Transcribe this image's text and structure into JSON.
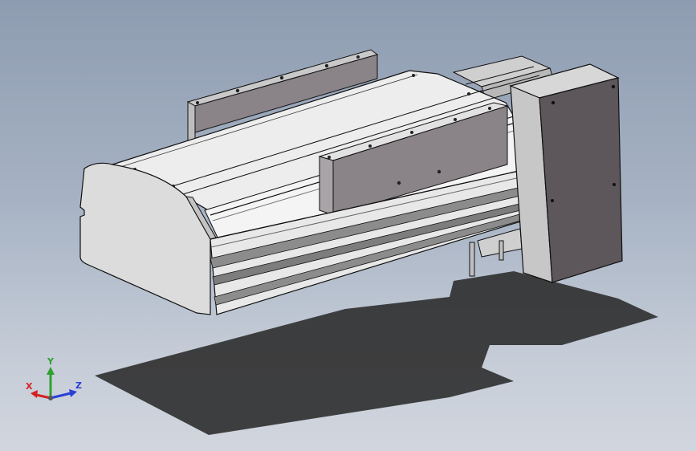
{
  "viewport": {
    "background_top": "#8e9cb1",
    "background_bottom": "#d1d6de"
  },
  "model": {
    "description_icon": "linear-actuator-model",
    "body_color": "#d8d8d8",
    "dark_face_color": "#5d575b",
    "shadow_color": "#2e2e2e"
  },
  "triad": {
    "x_label": "X",
    "y_label": "Y",
    "z_label": "Z",
    "x_color": "#d42222",
    "y_color": "#2fa02f",
    "z_color": "#2a3fd6"
  }
}
